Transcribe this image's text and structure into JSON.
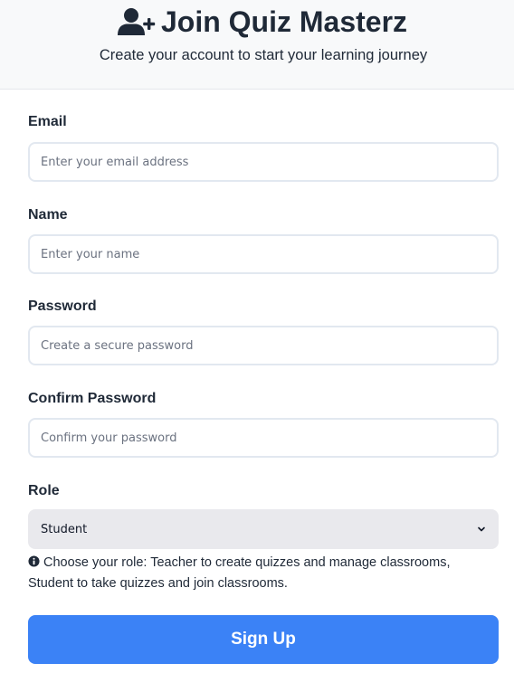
{
  "header": {
    "title": "Join Quiz Masterz",
    "subtitle": "Create your account to start your learning journey",
    "title_icon": "user-plus-icon"
  },
  "form": {
    "email": {
      "label": "Email",
      "placeholder": "Enter your email address",
      "value": ""
    },
    "name": {
      "label": "Name",
      "placeholder": "Enter your name",
      "value": ""
    },
    "password": {
      "label": "Password",
      "placeholder": "Create a secure password",
      "value": ""
    },
    "confirm_password": {
      "label": "Confirm Password",
      "placeholder": "Confirm your password",
      "value": ""
    },
    "role": {
      "label": "Role",
      "selected": "Student",
      "icon": "chevron-down-icon"
    },
    "role_hint": "Choose your role: Teacher to create quizzes and manage classrooms, Student to take quizzes and join classrooms.",
    "role_hint_icon": "info-circle-icon",
    "submit_label": "Sign Up"
  },
  "colors": {
    "accent": "#3b82f6",
    "header_bg": "#f8f9fa",
    "text": "#1f2937",
    "input_border": "#e2e8f0",
    "select_bg": "#e9e9ed"
  }
}
